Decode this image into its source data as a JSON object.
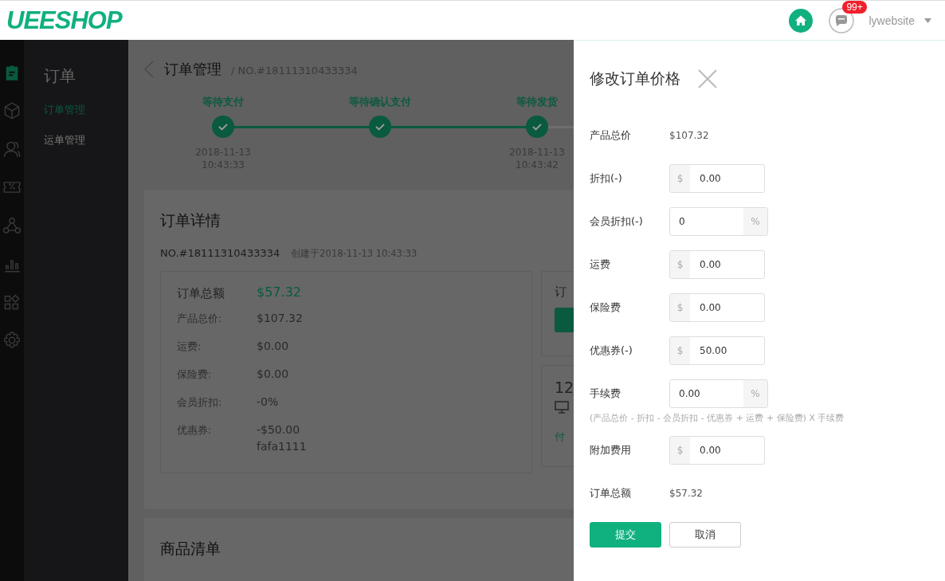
{
  "header": {
    "logo": "UEESHOP",
    "badge": "99+",
    "username": "lywebsite"
  },
  "icon_bar": [
    {
      "kind": "clipboard",
      "selected": true
    },
    {
      "kind": "box",
      "selected": false
    },
    {
      "kind": "users",
      "selected": false
    },
    {
      "kind": "coupon",
      "selected": false
    },
    {
      "kind": "share",
      "selected": false
    },
    {
      "kind": "chart",
      "selected": false
    },
    {
      "kind": "apps",
      "selected": false
    },
    {
      "kind": "gear",
      "selected": false
    }
  ],
  "sidebar": {
    "title": "订单",
    "items": [
      {
        "label": "订单管理",
        "selected": true
      },
      {
        "label": "运单管理",
        "selected": false
      }
    ]
  },
  "breadcrumb": {
    "title": "订单管理",
    "order_no": "/ NO.#18111310433334"
  },
  "steps": [
    {
      "label": "等待支付",
      "done": true,
      "date": "2018-11-13",
      "time": "10:43:33"
    },
    {
      "label": "等待确认支付",
      "done": true
    },
    {
      "label": "等待发货",
      "done": true,
      "date": "2018-11-13",
      "time": "10:43:42"
    }
  ],
  "order_detail": {
    "title": "订单详情",
    "order_no": "NO.#18111310433334",
    "created": "创建于2018-11-13 10:43:33",
    "total_label": "订单总额",
    "total": "$57.32",
    "rows": [
      {
        "label": "产品总价:",
        "value": "$107.32"
      },
      {
        "label": "运费:",
        "value": "$0.00"
      },
      {
        "label": "保险费:",
        "value": "$0.00"
      },
      {
        "label": "会员折扣:",
        "value": "-0%"
      },
      {
        "label": "优惠券:",
        "value": "-$50.00",
        "note": "fafa1111"
      }
    ],
    "side_card_1": {
      "title": "订"
    },
    "side_card_2": {
      "title": "12",
      "link": "付"
    }
  },
  "goods_list": {
    "title": "商品清单"
  },
  "price_panel": {
    "title": "修改订单价格",
    "rows": [
      {
        "kind": "text",
        "label": "产品总价",
        "value": "$107.32"
      },
      {
        "kind": "input",
        "label": "折扣(-)",
        "prefix": "$",
        "value": "0.00"
      },
      {
        "kind": "input",
        "label": "会员折扣(-)",
        "suffix": "%",
        "value": "0"
      },
      {
        "kind": "input",
        "label": "运费",
        "prefix": "$",
        "value": "0.00"
      },
      {
        "kind": "input",
        "label": "保险费",
        "prefix": "$",
        "value": "0.00"
      },
      {
        "kind": "input",
        "label": "优惠券(-)",
        "prefix": "$",
        "value": "50.00"
      },
      {
        "kind": "input",
        "label": "手续费",
        "suffix": "%",
        "value": "0.00",
        "hint": "(产品总价 - 折扣 - 会员折扣 - 优惠券 + 运费 + 保险费) X 手续费"
      },
      {
        "kind": "input",
        "label": "附加费用",
        "prefix": "$",
        "value": "0.00"
      },
      {
        "kind": "text",
        "label": "订单总额",
        "value": "$57.32"
      }
    ],
    "buttons": [
      {
        "label": "提交",
        "kind": "primary"
      },
      {
        "label": "取消",
        "kind": "secondary"
      }
    ]
  }
}
